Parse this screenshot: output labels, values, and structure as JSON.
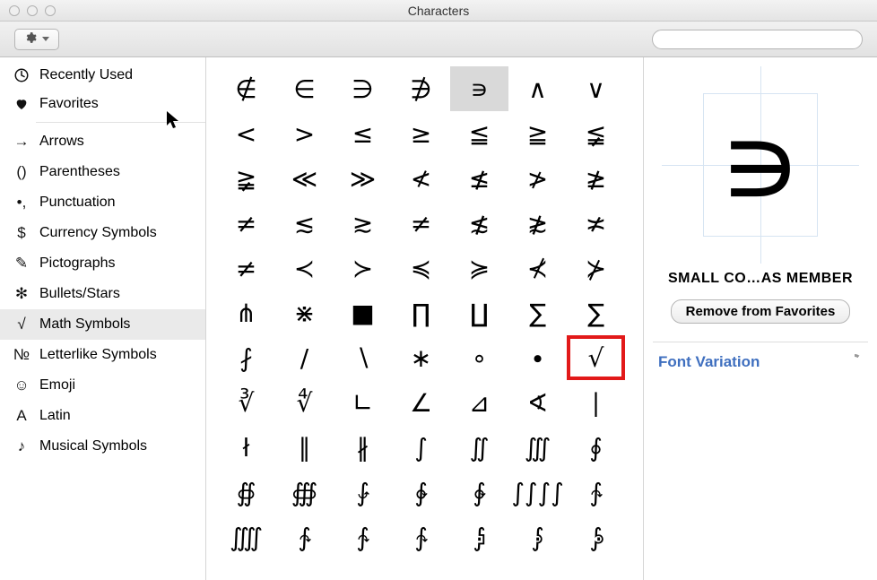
{
  "window": {
    "title": "Characters"
  },
  "toolbar": {
    "gear_label": "",
    "search_placeholder": ""
  },
  "sidebar": {
    "top": [
      {
        "icon": "clock",
        "label": "Recently Used"
      },
      {
        "icon": "heart",
        "label": "Favorites"
      }
    ],
    "categories": [
      {
        "icon": "→",
        "label": "Arrows"
      },
      {
        "icon": "()",
        "label": "Parentheses"
      },
      {
        "icon": "•,",
        "label": "Punctuation"
      },
      {
        "icon": "$",
        "label": "Currency Symbols"
      },
      {
        "icon": "✎",
        "label": "Pictographs"
      },
      {
        "icon": "✻",
        "label": "Bullets/Stars"
      },
      {
        "icon": "√",
        "label": "Math Symbols",
        "selected": true
      },
      {
        "icon": "№",
        "label": "Letterlike Symbols"
      },
      {
        "icon": "☺",
        "label": "Emoji"
      },
      {
        "icon": "A",
        "label": "Latin"
      },
      {
        "icon": "♪",
        "label": "Musical Symbols"
      }
    ]
  },
  "grid": {
    "columns": 7,
    "selected_index": 4,
    "highlight_index": 48,
    "chars": [
      "∉",
      "∈",
      "∋",
      "∌",
      "∍",
      "∧",
      "∨",
      "<",
      ">",
      "≤",
      "≥",
      "≦",
      "≧",
      "≨",
      "≩",
      "≪",
      "≫",
      "≮",
      "≰",
      "≯",
      "≱",
      "≠",
      "≲",
      "≳",
      "≠",
      "≴",
      "≵",
      "≭",
      "≠",
      "≺",
      "≻",
      "≼",
      "≽",
      "⊀",
      "⊁",
      "⋔",
      "⋇",
      "■",
      "∏",
      "∐",
      "∑",
      "∑",
      "⨏",
      "/",
      "∖",
      "∗",
      "∘",
      "∙",
      "√",
      "∛",
      "∜",
      "∟",
      "∠",
      "⊿",
      "∢",
      "∣",
      "ł",
      "∥",
      "∦",
      "∫",
      "∬",
      "∭",
      "∮",
      "∯",
      "∰",
      "⨑",
      "∲",
      "∲",
      "∫∫∫∫",
      "∱",
      "⨌",
      "∱",
      "∱",
      "∱",
      "⨒",
      "⨓",
      "⨔"
    ]
  },
  "detail": {
    "preview_char": "∍",
    "name": "SMALL CO…AS MEMBER",
    "remove_button": "Remove from Favorites",
    "font_variation_label": "Font Variation"
  }
}
